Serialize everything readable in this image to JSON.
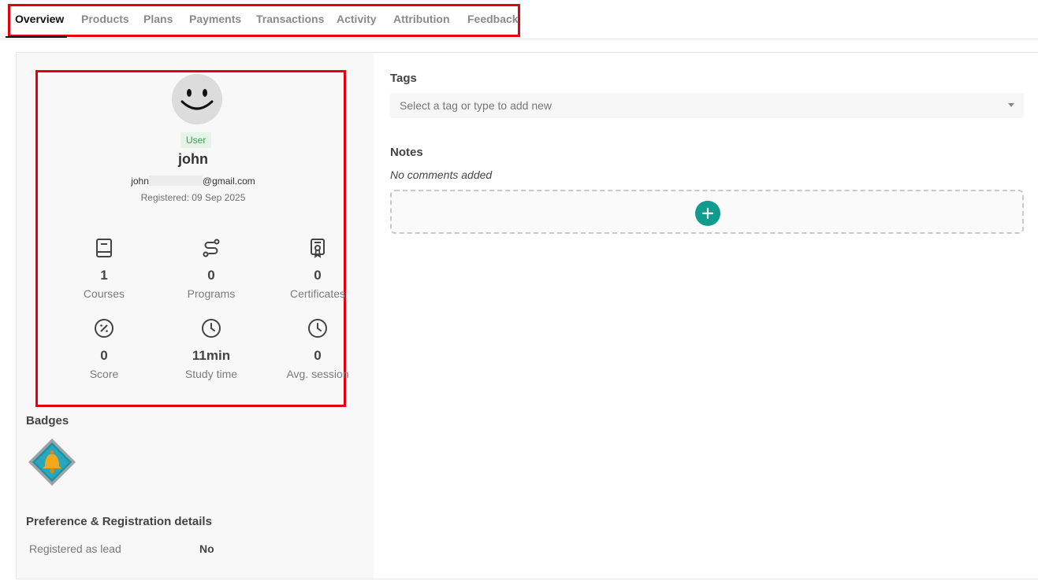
{
  "tabs": [
    {
      "label": "Overview",
      "active": true
    },
    {
      "label": "Products"
    },
    {
      "label": "Plans"
    },
    {
      "label": "Payments"
    },
    {
      "label": "Transactions"
    },
    {
      "label": "Activity"
    },
    {
      "label": "Attribution"
    },
    {
      "label": "Feedback"
    }
  ],
  "profile": {
    "avatar_icon": "smiley-face-icon",
    "role": "User",
    "name": "john",
    "email_prefix": "john",
    "email_suffix": "@gmail.com",
    "registered": "Registered: 09 Sep 2025"
  },
  "stats": [
    {
      "icon": "book-icon",
      "value": "1",
      "label": "Courses"
    },
    {
      "icon": "route-icon",
      "value": "0",
      "label": "Programs"
    },
    {
      "icon": "certificate-icon",
      "value": "0",
      "label": "Certificates"
    },
    {
      "icon": "score-percent-icon",
      "value": "0",
      "label": "Score"
    },
    {
      "icon": "clock-icon",
      "value": "11min",
      "label": "Study time"
    },
    {
      "icon": "clock-icon",
      "value": "0",
      "label": "Avg. session"
    }
  ],
  "badges": {
    "title": "Badges",
    "items": [
      {
        "icon": "bell-badge-icon"
      }
    ]
  },
  "preferences": {
    "title": "Preference & Registration details",
    "rows": [
      {
        "label": "Registered as lead",
        "value": "No"
      }
    ]
  },
  "tags": {
    "title": "Tags",
    "placeholder": "Select a tag or type to add new"
  },
  "notes": {
    "title": "Notes",
    "empty_text": "No comments added",
    "add_icon": "plus-icon"
  },
  "colors": {
    "accent": "#0f9b8e",
    "highlight": "#e5000f",
    "role_badge": "#3a9d52"
  }
}
